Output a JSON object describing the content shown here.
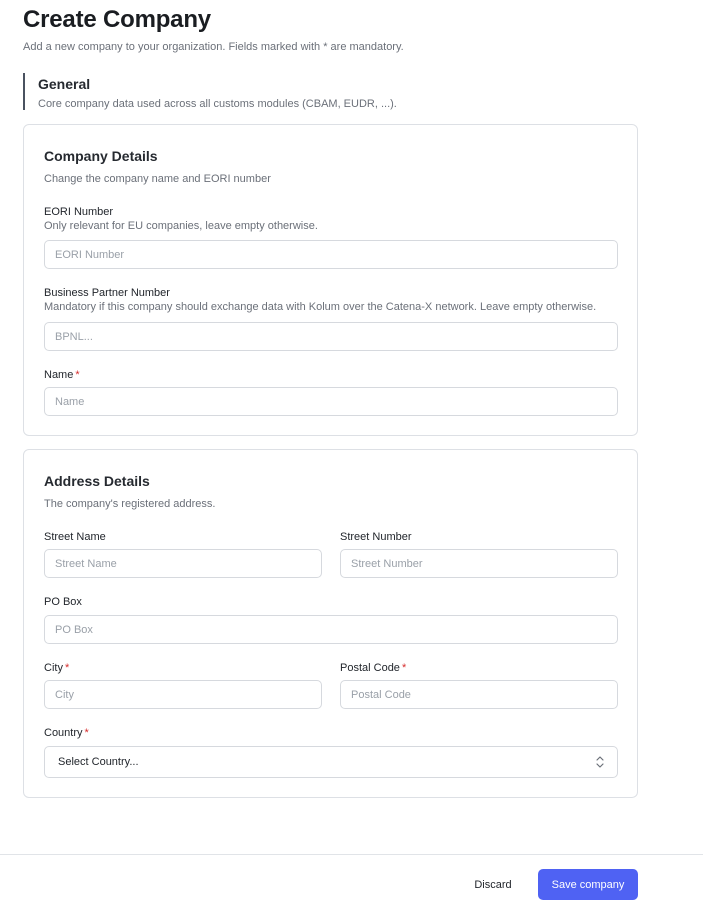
{
  "header": {
    "title": "Create Company",
    "subtitle": "Add a new company to your organization. Fields marked with * are mandatory."
  },
  "general": {
    "title": "General",
    "description": "Core company data used across all customs modules (CBAM, EUDR, ...)."
  },
  "company_details": {
    "title": "Company Details",
    "description": "Change the company name and EORI number",
    "eori": {
      "label": "EORI Number",
      "hint": "Only relevant for EU companies, leave empty otherwise.",
      "placeholder": "EORI Number",
      "value": ""
    },
    "bpn": {
      "label": "Business Partner Number",
      "hint": "Mandatory if this company should exchange data with Kolum over the Catena-X network. Leave empty otherwise.",
      "placeholder": "BPNL...",
      "value": ""
    },
    "name": {
      "label": "Name",
      "required_mark": "*",
      "placeholder": "Name",
      "value": ""
    }
  },
  "address_details": {
    "title": "Address Details",
    "description": "The company's registered address.",
    "street_name": {
      "label": "Street Name",
      "placeholder": "Street Name",
      "value": ""
    },
    "street_number": {
      "label": "Street Number",
      "placeholder": "Street Number",
      "value": ""
    },
    "po_box": {
      "label": "PO Box",
      "placeholder": "PO Box",
      "value": ""
    },
    "city": {
      "label": "City",
      "required_mark": "*",
      "placeholder": "City",
      "value": ""
    },
    "postal_code": {
      "label": "Postal Code",
      "required_mark": "*",
      "placeholder": "Postal Code",
      "value": ""
    },
    "country": {
      "label": "Country",
      "required_mark": "*",
      "selected": "Select Country...",
      "icon": "chevron-up-down-icon"
    }
  },
  "footer": {
    "discard_label": "Discard",
    "save_label": "Save company"
  },
  "colors": {
    "primary": "#4f62f3",
    "required": "#d62d2d",
    "border": "#dde0e5"
  }
}
